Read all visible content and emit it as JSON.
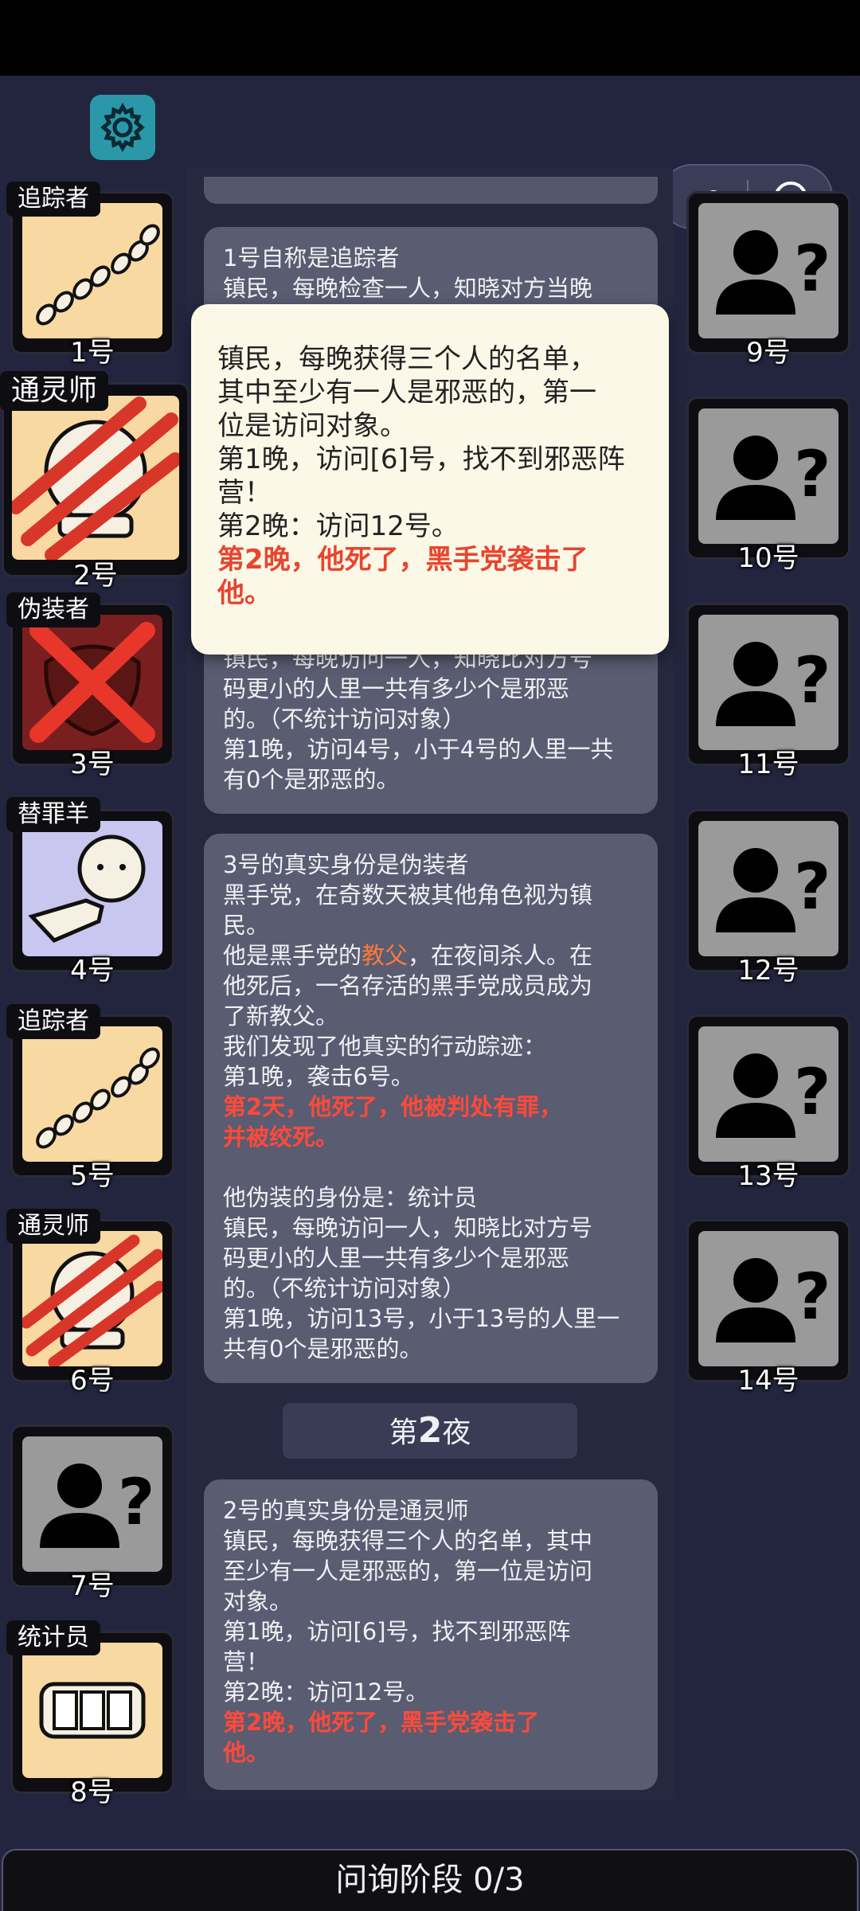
{
  "players_left": [
    {
      "number": "1号",
      "role": "追踪者",
      "portrait": "footprints-icon"
    },
    {
      "number": "2号",
      "role": "通灵师",
      "portrait": "crystal-ball-icon",
      "dead": true
    },
    {
      "number": "3号",
      "role": "伪装者",
      "portrait": "mask-icon",
      "executed": true
    },
    {
      "number": "4号",
      "role": "替罪羊",
      "portrait": "sheep-icon"
    },
    {
      "number": "5号",
      "role": "追踪者",
      "portrait": "footprints-icon"
    },
    {
      "number": "6号",
      "role": "通灵师",
      "portrait": "crystal-ball-icon"
    },
    {
      "number": "7号",
      "role": "",
      "portrait": "unknown-user-icon"
    },
    {
      "number": "8号",
      "role": "统计员",
      "portrait": "counter-icon"
    }
  ],
  "players_right": [
    {
      "number": "9号",
      "portrait": "unknown-user-icon"
    },
    {
      "number": "10号",
      "portrait": "unknown-user-icon"
    },
    {
      "number": "11号",
      "portrait": "unknown-user-icon"
    },
    {
      "number": "12号",
      "portrait": "unknown-user-icon"
    },
    {
      "number": "13号",
      "portrait": "unknown-user-icon"
    },
    {
      "number": "14号",
      "portrait": "unknown-user-icon"
    }
  ],
  "feed": {
    "entry1": {
      "line1": "1号自称是追踪者",
      "line2": "镇民，每晚检查一人，知晓对方当晚"
    },
    "entry2": {
      "line1": "镇民，每晚访问一人，知晓比对方号",
      "line2": "码更小的人里一共有多少个是邪恶",
      "line3": "的。（不统计访问对象）",
      "line4": "第1晚，访问4号，小于4号的人里一共",
      "line5": "有0个是邪恶的。"
    },
    "entry3": {
      "line1": "3号的真实身份是伪装者",
      "line2": "黑手党，在奇数天被其他角色视为镇",
      "line3": "民。",
      "line4a": "他是黑手党的",
      "line4b": "教父",
      "line4c": "，在夜间杀人。在",
      "line5": "他死后，一名存活的黑手党成员成为",
      "line6": "了新教父。",
      "line7": "我们发现了他真实的行动踪迹：",
      "line8": "第1晚，袭击6号。",
      "line9": "第2天，他死了，他被判处有罪，",
      "line10": "并被绞死。",
      "line11": "他伪装的身份是：统计员",
      "line12": "镇民，每晚访问一人，知晓比对方号",
      "line13": "码更小的人里一共有多少个是邪恶",
      "line14": "的。（不统计访问对象）",
      "line15": "第1晚，访问13号，小于13号的人里一",
      "line16": "共有0个是邪恶的。"
    },
    "night_header_prefix": "第",
    "night_header_num": "2",
    "night_header_suffix": "夜",
    "entry4": {
      "line1": "2号的真实身份是通灵师",
      "line2": "镇民，每晚获得三个人的名单，其中",
      "line3": "至少有一人是邪恶的，第一位是访问",
      "line4": "对象。",
      "line5": "第1晚，访问[6]号，找不到邪恶阵",
      "line6": "营！",
      "line7": "第2晚：访问12号。",
      "line8": "第2晚，他死了，黑手党袭击了",
      "line9": "他。"
    }
  },
  "popup": {
    "line1": "镇民，每晚获得三个人的名单，",
    "line2": "其中至少有一人是邪恶的，第一",
    "line3": "位是访问对象。",
    "line4": "第1晚，访问[6]号，找不到邪恶阵",
    "line5": "营！",
    "line6": "第2晚：访问12号。",
    "line7": "第2晚，他死了，黑手党袭击了",
    "line8": "他。"
  },
  "bottom_status": "问询阶段 0/3",
  "colors": {
    "accent_red": "#ff4a3a",
    "teal_button": "#2a98a8",
    "background": "#23253f"
  }
}
